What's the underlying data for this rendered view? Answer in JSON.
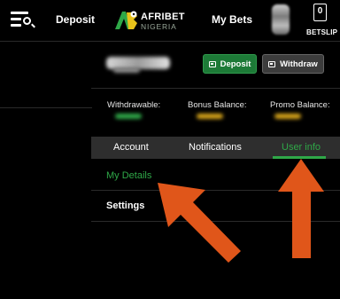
{
  "header": {
    "deposit_label": "Deposit",
    "logo": {
      "brand": "AFRIBET",
      "sub": "NIGERIA"
    },
    "mybets_label": "My Bets",
    "betslip": {
      "count": "0",
      "label": "BETSLIP"
    }
  },
  "account": {
    "deposit_button": "Deposit",
    "withdraw_button": "Withdraw",
    "balances": [
      {
        "label": "Withdrawable:"
      },
      {
        "label": "Bonus Balance:"
      },
      {
        "label": "Promo Balance:"
      }
    ]
  },
  "tabs": {
    "items": [
      {
        "label": "Account"
      },
      {
        "label": "Notifications"
      },
      {
        "label": "User info"
      }
    ],
    "active_index": 2
  },
  "menu": {
    "items": [
      {
        "label": "My Details"
      },
      {
        "label": "Settings"
      }
    ]
  },
  "colors": {
    "accent_green": "#2fa848",
    "deposit_button": "#1d7a37",
    "annotation_arrow": "#e0561a"
  }
}
